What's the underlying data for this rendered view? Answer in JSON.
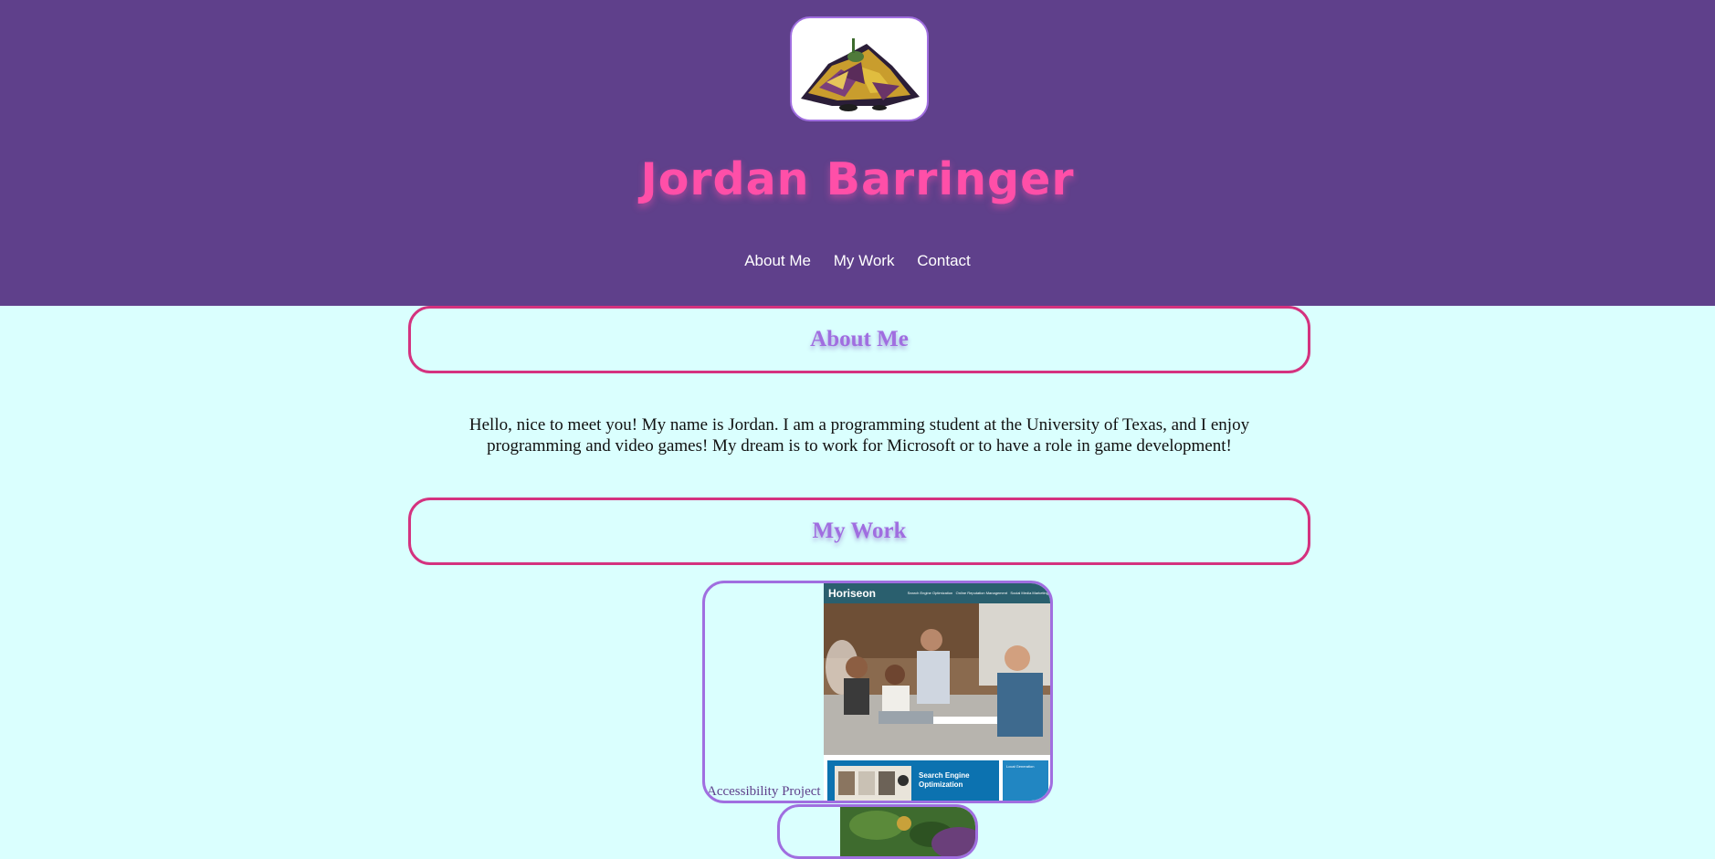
{
  "header": {
    "name": "Jordan Barringer",
    "avatar_icon": "rock-pile-avatar-icon",
    "nav": [
      "About Me",
      "My Work",
      "Contact"
    ]
  },
  "about": {
    "heading": "About Me",
    "text": "Hello, nice to meet you! My name is Jordan. I am a programming student at the University of Texas, and I enjoy programming and video games! My dream is to work for Microsoft or to have a role in game development!"
  },
  "work": {
    "heading": "My Work",
    "projects": [
      {
        "caption": "Accessibility Project",
        "screenshot": {
          "brand": "Horiseon",
          "links": [
            "Search Engine Optimization",
            "Online Reputation Management",
            "Social Media Marketing"
          ],
          "feature_title": "Search Engine Optimization",
          "side_title": "Local Generation"
        }
      }
    ]
  },
  "colors": {
    "header_bg": "#5f408b",
    "page_bg": "#dafffe",
    "name_pink": "#ff4fa8",
    "heading_purple": "#a06ee0",
    "border_pink": "#d4327f"
  }
}
